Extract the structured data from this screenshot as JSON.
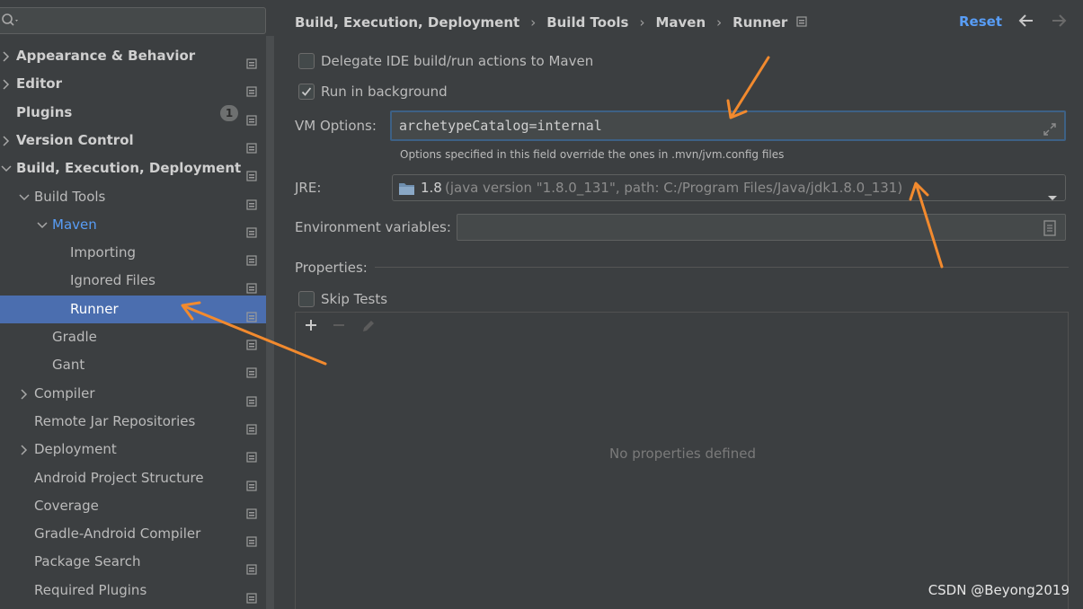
{
  "sidebar": {
    "search": {
      "value": "",
      "placeholder": ""
    },
    "items": [
      {
        "label": "Appearance & Behavior",
        "indent": 0,
        "expandable": true,
        "expanded": false,
        "bold": true
      },
      {
        "label": "Editor",
        "indent": 0,
        "expandable": true,
        "expanded": false,
        "bold": true
      },
      {
        "label": "Plugins",
        "indent": 0,
        "expandable": false,
        "bold": true,
        "badge": "1"
      },
      {
        "label": "Version Control",
        "indent": 0,
        "expandable": true,
        "expanded": false,
        "bold": true
      },
      {
        "label": "Build, Execution, Deployment",
        "indent": 0,
        "expandable": true,
        "expanded": true,
        "bold": true
      },
      {
        "label": "Build Tools",
        "indent": 1,
        "expandable": true,
        "expanded": true
      },
      {
        "label": "Maven",
        "indent": 2,
        "expandable": true,
        "expanded": true,
        "link": true
      },
      {
        "label": "Importing",
        "indent": 3,
        "expandable": false
      },
      {
        "label": "Ignored Files",
        "indent": 3,
        "expandable": false
      },
      {
        "label": "Runner",
        "indent": 3,
        "expandable": false,
        "selected": true
      },
      {
        "label": "Gradle",
        "indent": 2,
        "expandable": false
      },
      {
        "label": "Gant",
        "indent": 2,
        "expandable": false
      },
      {
        "label": "Compiler",
        "indent": 1,
        "expandable": true,
        "expanded": false
      },
      {
        "label": "Remote Jar Repositories",
        "indent": 1,
        "expandable": false
      },
      {
        "label": "Deployment",
        "indent": 1,
        "expandable": true,
        "expanded": false
      },
      {
        "label": "Android Project Structure",
        "indent": 1,
        "expandable": false
      },
      {
        "label": "Coverage",
        "indent": 1,
        "expandable": false
      },
      {
        "label": "Gradle-Android Compiler",
        "indent": 1,
        "expandable": false
      },
      {
        "label": "Package Search",
        "indent": 1,
        "expandable": false
      },
      {
        "label": "Required Plugins",
        "indent": 1,
        "expandable": false
      }
    ]
  },
  "header": {
    "breadcrumb": [
      "Build, Execution, Deployment",
      "Build Tools",
      "Maven",
      "Runner"
    ],
    "reset_label": "Reset"
  },
  "runner": {
    "delegate": {
      "label": "Delegate IDE build/run actions to Maven",
      "checked": false
    },
    "background": {
      "label": "Run in background",
      "checked": true
    },
    "vm_options": {
      "label": "VM Options:",
      "value": "archetypeCatalog=internal",
      "hint": "Options specified in this field override the ones in .mvn/jvm.config files"
    },
    "jre": {
      "label": "JRE:",
      "version": "1.8",
      "detail": "(java version \"1.8.0_131\", path: C:/Program Files/Java/jdk1.8.0_131)"
    },
    "env": {
      "label": "Environment variables:",
      "value": ""
    },
    "properties": {
      "label": "Properties:",
      "empty_text": "No properties defined"
    },
    "skip_tests": {
      "label": "Skip Tests",
      "checked": false
    }
  },
  "watermark": "CSDN @Beyong2019",
  "colors": {
    "accent": "#589df6",
    "selection": "#4b6eaf",
    "arrow": "#f28a2e",
    "background": "#3c3f41"
  }
}
